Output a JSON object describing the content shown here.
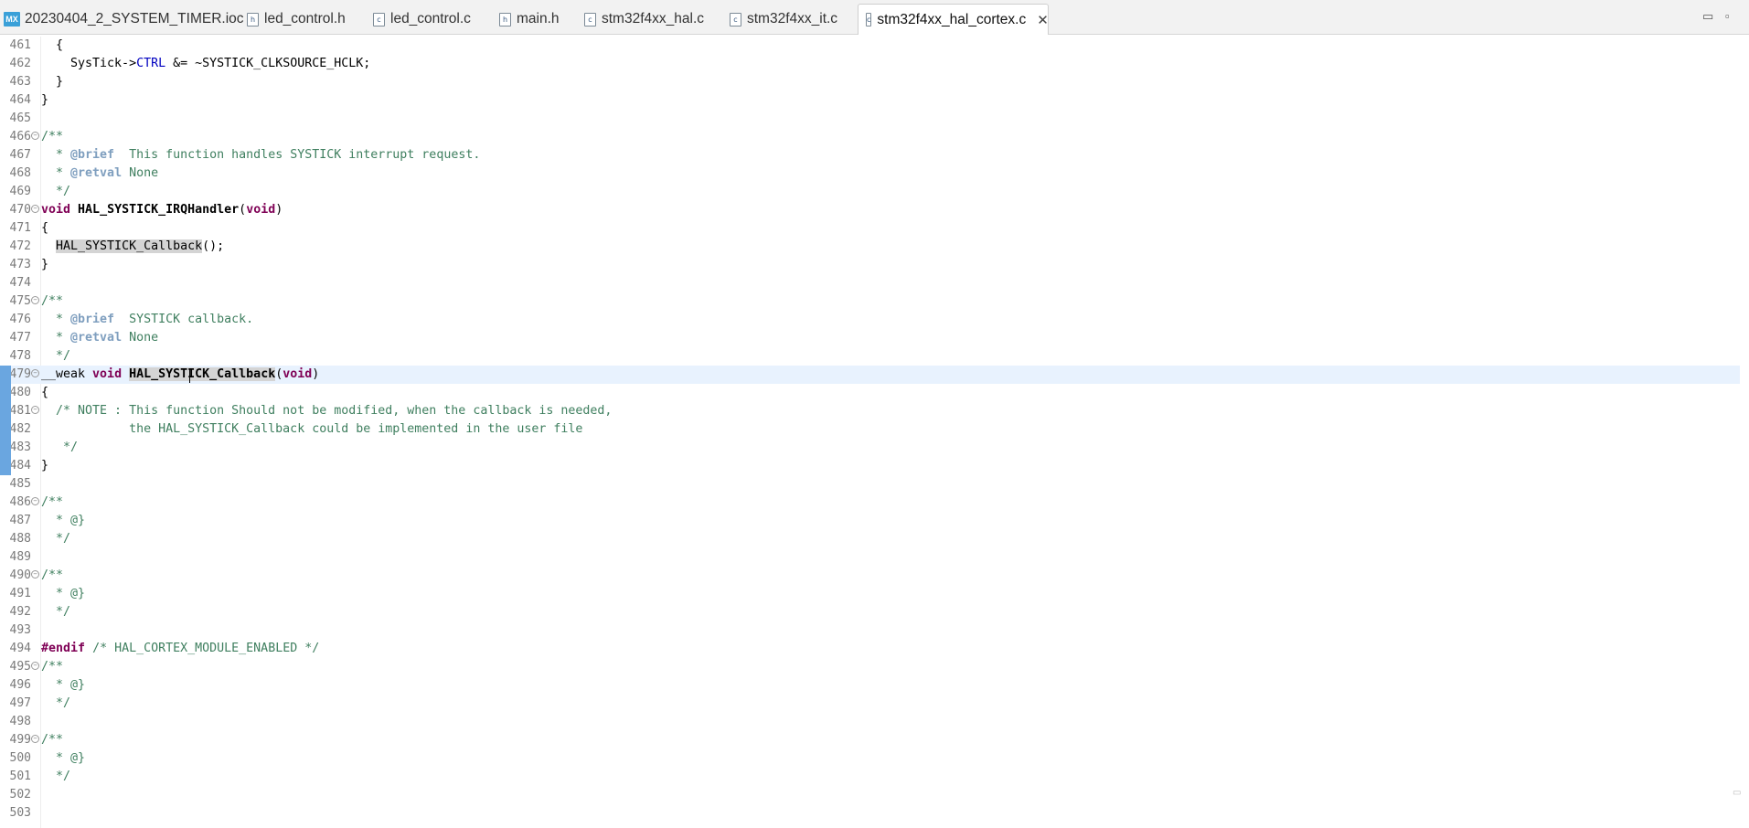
{
  "tabs": [
    {
      "label": "20230404_2_SYSTEM_TIMER.ioc",
      "icon": "MX"
    },
    {
      "label": "led_control.h",
      "icon": "h"
    },
    {
      "label": "led_control.c",
      "icon": "c"
    },
    {
      "label": "main.h",
      "icon": "h"
    },
    {
      "label": "stm32f4xx_hal.c",
      "icon": "c"
    },
    {
      "label": "stm32f4xx_it.c",
      "icon": "c"
    },
    {
      "label": "stm32f4xx_hal_cortex.c",
      "icon": "c",
      "active": true
    }
  ],
  "window_controls": {
    "minimize": "▭",
    "maximize": "▫"
  },
  "editor": {
    "current_line": 479,
    "lines": [
      {
        "n": "461",
        "code": "  {"
      },
      {
        "n": "462",
        "code": "    SysTick->CTRL &= ~SYSTICK_CLKSOURCE_HCLK;"
      },
      {
        "n": "463",
        "code": "  }"
      },
      {
        "n": "464",
        "code": "}"
      },
      {
        "n": "465",
        "code": ""
      },
      {
        "n": "466",
        "code": "/**"
      },
      {
        "n": "467",
        "code": "  * @brief  This function handles SYSTICK interrupt request."
      },
      {
        "n": "468",
        "code": "  * @retval None"
      },
      {
        "n": "469",
        "code": "  */"
      },
      {
        "n": "470",
        "code": "void HAL_SYSTICK_IRQHandler(void)"
      },
      {
        "n": "471",
        "code": "{"
      },
      {
        "n": "472",
        "code": "  HAL_SYSTICK_Callback();"
      },
      {
        "n": "473",
        "code": "}"
      },
      {
        "n": "474",
        "code": ""
      },
      {
        "n": "475",
        "code": "/**"
      },
      {
        "n": "476",
        "code": "  * @brief  SYSTICK callback."
      },
      {
        "n": "477",
        "code": "  * @retval None"
      },
      {
        "n": "478",
        "code": "  */"
      },
      {
        "n": "479",
        "code": "__weak void HAL_SYSTICK_Callback(void)"
      },
      {
        "n": "480",
        "code": "{"
      },
      {
        "n": "481",
        "code": "  /* NOTE : This function Should not be modified, when the callback is needed,"
      },
      {
        "n": "482",
        "code": "            the HAL_SYSTICK_Callback could be implemented in the user file"
      },
      {
        "n": "483",
        "code": "   */"
      },
      {
        "n": "484",
        "code": "}"
      },
      {
        "n": "485",
        "code": ""
      },
      {
        "n": "486",
        "code": "/**"
      },
      {
        "n": "487",
        "code": "  * @}"
      },
      {
        "n": "488",
        "code": "  */"
      },
      {
        "n": "489",
        "code": ""
      },
      {
        "n": "490",
        "code": "/**"
      },
      {
        "n": "491",
        "code": "  * @}"
      },
      {
        "n": "492",
        "code": "  */"
      },
      {
        "n": "493",
        "code": ""
      },
      {
        "n": "494",
        "code": "#endif /* HAL_CORTEX_MODULE_ENABLED */"
      },
      {
        "n": "495",
        "code": "/**"
      },
      {
        "n": "496",
        "code": "  * @}"
      },
      {
        "n": "497",
        "code": "  */"
      },
      {
        "n": "498",
        "code": ""
      },
      {
        "n": "499",
        "code": "/**"
      },
      {
        "n": "500",
        "code": "  * @}"
      },
      {
        "n": "501",
        "code": "  */"
      },
      {
        "n": "502",
        "code": ""
      },
      {
        "n": "503",
        "code": ""
      }
    ],
    "folds": [
      "466",
      "470",
      "475",
      "479",
      "481",
      "486",
      "490",
      "495",
      "499"
    ]
  },
  "colors": {
    "keyword": "#7f0055",
    "comment": "#3f7f5f",
    "field": "#0000c0",
    "current_line": "#e8f2fe",
    "change_bar": "#6aa6e0"
  }
}
